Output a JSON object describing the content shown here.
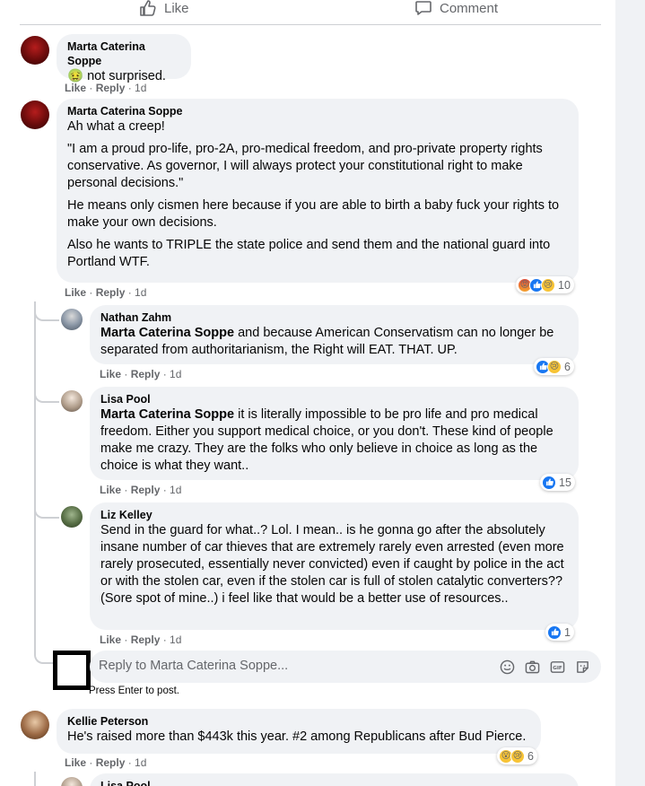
{
  "action_bar": {
    "like_label": "Like",
    "comment_label": "Comment"
  },
  "comments": [
    {
      "author": "Marta Caterina Soppe",
      "text": "not surprised.",
      "emoji": "🤢",
      "meta": {
        "like": "Like",
        "reply": "Reply",
        "time": "1d"
      }
    },
    {
      "author": "Marta Caterina Soppe",
      "paragraphs": [
        "Ah what a creep!",
        "\"I am a proud pro-life, pro-2A, pro-medical freedom, and pro-private property rights conservative. As governor, I will always protect your constitutional right to make personal decisions.\"",
        "He means only cismen here because if you are able to birth a baby fuck your rights to make your own decisions.",
        "Also he wants to TRIPLE the state police and send them and the national guard into Portland WTF."
      ],
      "meta": {
        "like": "Like",
        "reply": "Reply",
        "time": "1d"
      },
      "reactions": {
        "count": "10"
      }
    }
  ],
  "replies": [
    {
      "author": "Nathan Zahm",
      "mention": "Marta Caterina Soppe",
      "text": " and because American Conservatism can no longer be separated from authoritarianism, the Right will EAT. THAT. UP.",
      "meta": {
        "like": "Like",
        "reply": "Reply",
        "time": "1d"
      },
      "reactions": {
        "count": "6"
      }
    },
    {
      "author": "Lisa Pool",
      "mention": "Marta Caterina Soppe",
      "text": " it is literally impossible to be pro life and pro medical freedom. Either you support medical choice, or you don't. These kind of people make me crazy. They are the folks who only believe in choice as long as the choice is what they want..",
      "meta": {
        "like": "Like",
        "reply": "Reply",
        "time": "1d"
      },
      "reactions": {
        "count": "15"
      }
    },
    {
      "author": "Liz Kelley",
      "text": "Send in the guard for what..? Lol. I mean.. is he gonna go after the absolutely insane number of car thieves that are extremely rarely even arrested (even more rarely prosecuted, essentially never convicted) even if caught by police in the act or with the stolen car, even if the stolen car is full of stolen catalytic converters?? (Sore spot of mine..) i feel like that would be a better use of resources..",
      "meta": {
        "like": "Like",
        "reply": "Reply",
        "time": "1d"
      },
      "reactions": {
        "count": "1"
      }
    }
  ],
  "composer": {
    "placeholder": "Reply to Marta Caterina Soppe...",
    "hint": "Press Enter to post."
  },
  "comment3": {
    "author": "Kellie Peterson",
    "text": "He's raised more than $443k this year. #2 among Republicans after Bud Pierce.",
    "meta": {
      "like": "Like",
      "reply": "Reply",
      "time": "1d"
    },
    "reactions": {
      "count": "6"
    }
  },
  "partial_reply_author": "Lisa Pool",
  "colors": {
    "link_blue": "#1877f2",
    "bubble_gray": "#f0f2f5",
    "meta_gray": "#65676b"
  }
}
